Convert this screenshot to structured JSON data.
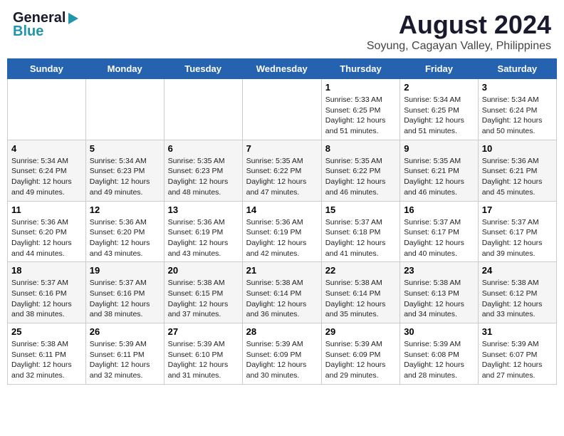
{
  "header": {
    "logo_line1": "General",
    "logo_line2": "Blue",
    "title": "August 2024",
    "subtitle": "Soyung, Cagayan Valley, Philippines"
  },
  "days_of_week": [
    "Sunday",
    "Monday",
    "Tuesday",
    "Wednesday",
    "Thursday",
    "Friday",
    "Saturday"
  ],
  "weeks": [
    [
      {
        "num": "",
        "info": ""
      },
      {
        "num": "",
        "info": ""
      },
      {
        "num": "",
        "info": ""
      },
      {
        "num": "",
        "info": ""
      },
      {
        "num": "1",
        "info": "Sunrise: 5:33 AM\nSunset: 6:25 PM\nDaylight: 12 hours and 51 minutes."
      },
      {
        "num": "2",
        "info": "Sunrise: 5:34 AM\nSunset: 6:25 PM\nDaylight: 12 hours and 51 minutes."
      },
      {
        "num": "3",
        "info": "Sunrise: 5:34 AM\nSunset: 6:24 PM\nDaylight: 12 hours and 50 minutes."
      }
    ],
    [
      {
        "num": "4",
        "info": "Sunrise: 5:34 AM\nSunset: 6:24 PM\nDaylight: 12 hours and 49 minutes."
      },
      {
        "num": "5",
        "info": "Sunrise: 5:34 AM\nSunset: 6:23 PM\nDaylight: 12 hours and 49 minutes."
      },
      {
        "num": "6",
        "info": "Sunrise: 5:35 AM\nSunset: 6:23 PM\nDaylight: 12 hours and 48 minutes."
      },
      {
        "num": "7",
        "info": "Sunrise: 5:35 AM\nSunset: 6:22 PM\nDaylight: 12 hours and 47 minutes."
      },
      {
        "num": "8",
        "info": "Sunrise: 5:35 AM\nSunset: 6:22 PM\nDaylight: 12 hours and 46 minutes."
      },
      {
        "num": "9",
        "info": "Sunrise: 5:35 AM\nSunset: 6:21 PM\nDaylight: 12 hours and 46 minutes."
      },
      {
        "num": "10",
        "info": "Sunrise: 5:36 AM\nSunset: 6:21 PM\nDaylight: 12 hours and 45 minutes."
      }
    ],
    [
      {
        "num": "11",
        "info": "Sunrise: 5:36 AM\nSunset: 6:20 PM\nDaylight: 12 hours and 44 minutes."
      },
      {
        "num": "12",
        "info": "Sunrise: 5:36 AM\nSunset: 6:20 PM\nDaylight: 12 hours and 43 minutes."
      },
      {
        "num": "13",
        "info": "Sunrise: 5:36 AM\nSunset: 6:19 PM\nDaylight: 12 hours and 43 minutes."
      },
      {
        "num": "14",
        "info": "Sunrise: 5:36 AM\nSunset: 6:19 PM\nDaylight: 12 hours and 42 minutes."
      },
      {
        "num": "15",
        "info": "Sunrise: 5:37 AM\nSunset: 6:18 PM\nDaylight: 12 hours and 41 minutes."
      },
      {
        "num": "16",
        "info": "Sunrise: 5:37 AM\nSunset: 6:17 PM\nDaylight: 12 hours and 40 minutes."
      },
      {
        "num": "17",
        "info": "Sunrise: 5:37 AM\nSunset: 6:17 PM\nDaylight: 12 hours and 39 minutes."
      }
    ],
    [
      {
        "num": "18",
        "info": "Sunrise: 5:37 AM\nSunset: 6:16 PM\nDaylight: 12 hours and 38 minutes."
      },
      {
        "num": "19",
        "info": "Sunrise: 5:37 AM\nSunset: 6:16 PM\nDaylight: 12 hours and 38 minutes."
      },
      {
        "num": "20",
        "info": "Sunrise: 5:38 AM\nSunset: 6:15 PM\nDaylight: 12 hours and 37 minutes."
      },
      {
        "num": "21",
        "info": "Sunrise: 5:38 AM\nSunset: 6:14 PM\nDaylight: 12 hours and 36 minutes."
      },
      {
        "num": "22",
        "info": "Sunrise: 5:38 AM\nSunset: 6:14 PM\nDaylight: 12 hours and 35 minutes."
      },
      {
        "num": "23",
        "info": "Sunrise: 5:38 AM\nSunset: 6:13 PM\nDaylight: 12 hours and 34 minutes."
      },
      {
        "num": "24",
        "info": "Sunrise: 5:38 AM\nSunset: 6:12 PM\nDaylight: 12 hours and 33 minutes."
      }
    ],
    [
      {
        "num": "25",
        "info": "Sunrise: 5:38 AM\nSunset: 6:11 PM\nDaylight: 12 hours and 32 minutes."
      },
      {
        "num": "26",
        "info": "Sunrise: 5:39 AM\nSunset: 6:11 PM\nDaylight: 12 hours and 32 minutes."
      },
      {
        "num": "27",
        "info": "Sunrise: 5:39 AM\nSunset: 6:10 PM\nDaylight: 12 hours and 31 minutes."
      },
      {
        "num": "28",
        "info": "Sunrise: 5:39 AM\nSunset: 6:09 PM\nDaylight: 12 hours and 30 minutes."
      },
      {
        "num": "29",
        "info": "Sunrise: 5:39 AM\nSunset: 6:09 PM\nDaylight: 12 hours and 29 minutes."
      },
      {
        "num": "30",
        "info": "Sunrise: 5:39 AM\nSunset: 6:08 PM\nDaylight: 12 hours and 28 minutes."
      },
      {
        "num": "31",
        "info": "Sunrise: 5:39 AM\nSunset: 6:07 PM\nDaylight: 12 hours and 27 minutes."
      }
    ]
  ]
}
